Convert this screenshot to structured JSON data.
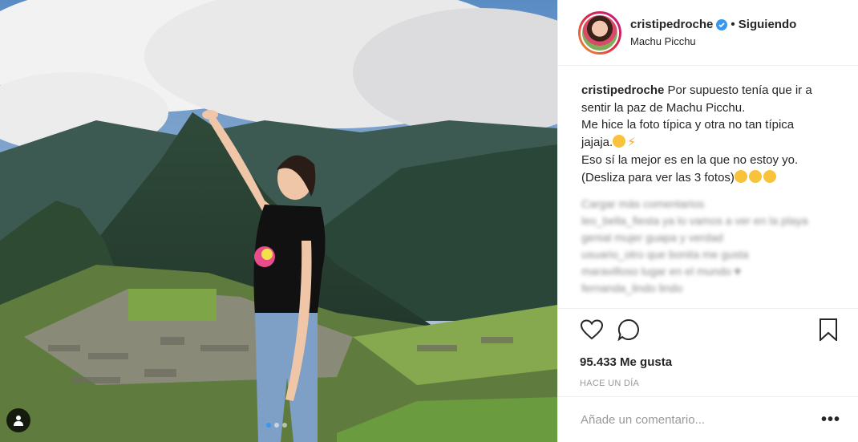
{
  "photo": {
    "alt_icon": "person-tag-icon",
    "carousel_count": 3,
    "carousel_active": 1
  },
  "header": {
    "username": "cristipedroche",
    "follow_status": "• Siguiendo",
    "location": "Machu Picchu"
  },
  "caption": {
    "username": "cristipedroche",
    "lines": [
      "Por supuesto tenía que ir a",
      "sentir la paz de Machu Picchu.",
      "Me hice la foto típica y otra no tan típica",
      "jajaja.",
      "Eso sí la mejor es en la que no estoy yo.",
      "(Desliza para ver las 3 fotos)"
    ],
    "bolt": "⚡"
  },
  "blurred_comments": [
    "Cargar más comentarios",
    "leo_bella_fiesta ya lo vamos a ver en la playa",
    "genial mujer guapa y verdad",
    "usuario_otro que bonita me gusta",
    "maravilloso lugar en el mundo ♥",
    "fernanda_lindo lindo"
  ],
  "actions": {
    "likes": "95.433 Me gusta",
    "time": "HACE UN DÍA"
  },
  "comment_box": {
    "placeholder": "Añade un comentario...",
    "more": "•••"
  },
  "colors": {
    "accent": "#3897f0",
    "text": "#262626",
    "muted": "#999999"
  }
}
